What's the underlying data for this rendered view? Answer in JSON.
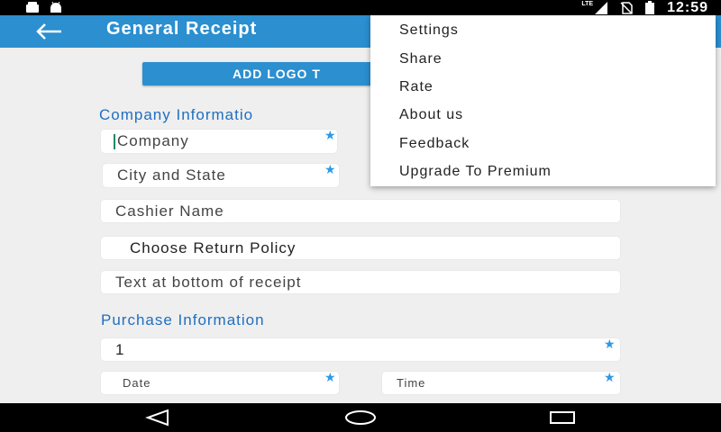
{
  "status_bar": {
    "time": "12:59",
    "network": "LTE",
    "icons": [
      "notification-icon",
      "android-icon",
      "lte-signal-icon",
      "no-sim-icon",
      "battery-icon"
    ]
  },
  "app_bar": {
    "title": "General Receipt",
    "back_icon": "back-arrow-icon",
    "color": "#2b8fd0"
  },
  "logo_button": {
    "label": "ADD LOGO T"
  },
  "company_section": {
    "title": "Company Informatio",
    "fields": {
      "company": "Company",
      "city_state": "City and State",
      "cashier": "Cashier Name",
      "return_policy": "Choose Return Policy",
      "bottom_text": "Text at bottom of receipt"
    }
  },
  "purchase_section": {
    "title": "Purchase Information",
    "fields": {
      "number": "1",
      "date": "Date",
      "time": "Time"
    }
  },
  "menu": {
    "items": [
      "Settings",
      "Share",
      "Rate",
      "About us",
      "Feedback",
      "Upgrade To Premium"
    ]
  },
  "nav_bar": {
    "icons": [
      "back-triangle-icon",
      "home-circle-icon",
      "recents-square-icon"
    ]
  }
}
